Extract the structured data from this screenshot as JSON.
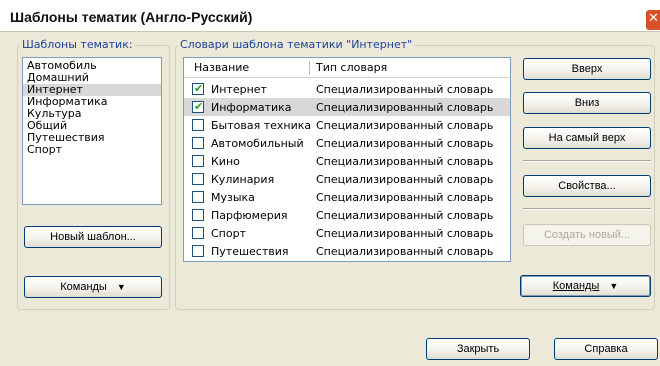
{
  "window": {
    "title": "Шаблоны тематик (Англо-Русский)"
  },
  "templates": {
    "legend": "Шаблоны тематик:",
    "items": [
      "Автомобиль",
      "Домашний",
      "Интернет",
      "Информатика",
      "Культура",
      "Общий",
      "Путешествия",
      "Спорт"
    ],
    "selected_index": 2,
    "new_button": "Новый шаблон...",
    "commands_button": "Команды"
  },
  "dictionaries": {
    "legend": "Словари шаблона тематики \"Интернет\"",
    "columns": {
      "name": "Название",
      "type": "Тип словаря"
    },
    "rows": [
      {
        "name": "Интернет",
        "type": "Специализированный словарь",
        "checked": true
      },
      {
        "name": "Информатика",
        "type": "Специализированный словарь",
        "checked": true
      },
      {
        "name": "Бытовая техника",
        "type": "Специализированный словарь",
        "checked": false
      },
      {
        "name": "Автомобильный",
        "type": "Специализированный словарь",
        "checked": false
      },
      {
        "name": "Кино",
        "type": "Специализированный словарь",
        "checked": false
      },
      {
        "name": "Кулинария",
        "type": "Специализированный словарь",
        "checked": false
      },
      {
        "name": "Музыка",
        "type": "Специализированный словарь",
        "checked": false
      },
      {
        "name": "Парфюмерия",
        "type": "Специализированный словарь",
        "checked": false
      },
      {
        "name": "Спорт",
        "type": "Специализированный словарь",
        "checked": false
      },
      {
        "name": "Путешествия",
        "type": "Специализированный словарь",
        "checked": false
      }
    ],
    "selected_index": 1
  },
  "side_buttons": {
    "up": "Вверх",
    "down": "Вниз",
    "top": "На самый верх",
    "properties": "Свойства...",
    "create_new": "Создать новый...",
    "commands": "Команды"
  },
  "footer": {
    "close": "Закрыть",
    "help": "Справка"
  },
  "colors": {
    "legend_text": "#1c3f9e",
    "check_mark": "#21a121",
    "close_button": "#d8502a",
    "window_bg": "#ece9d8"
  }
}
